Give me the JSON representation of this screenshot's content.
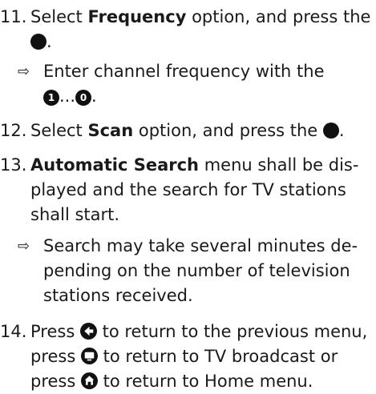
{
  "steps": {
    "s11": {
      "num": "11.",
      "pre": "Select ",
      "bold": "Frequency",
      "post": " option, and press the",
      "end": "."
    },
    "b11": {
      "arrow": "⇨",
      "text": "Enter channel frequency with the",
      "key_first": "1",
      "ellipsis": "...",
      "key_last": "0",
      "end": "."
    },
    "s12": {
      "num": "12.",
      "pre": "Select ",
      "bold": "Scan",
      "post": " option, and press the ",
      "end": "."
    },
    "s13": {
      "num": "13.",
      "bold": "Automatic Search",
      "post": " menu shall be dis-",
      "line2": "played and the search for TV stations",
      "line3": "shall start."
    },
    "b13": {
      "arrow": "⇨",
      "line1": "Search may take several minutes de-",
      "line2": "pending on the number of television",
      "line3": "stations received."
    },
    "s14": {
      "num": "14.",
      "pre": "Press ",
      "post1": " to return to the previous menu,",
      "pre2": "press ",
      "post2": " to return to TV broadcast or",
      "pre3": "press ",
      "post3": " to return to Home menu."
    }
  },
  "icons": {
    "ok": "ok-button-icon",
    "back": "back-arrow-icon",
    "tv": "tv-broadcast-icon",
    "home": "home-icon"
  }
}
